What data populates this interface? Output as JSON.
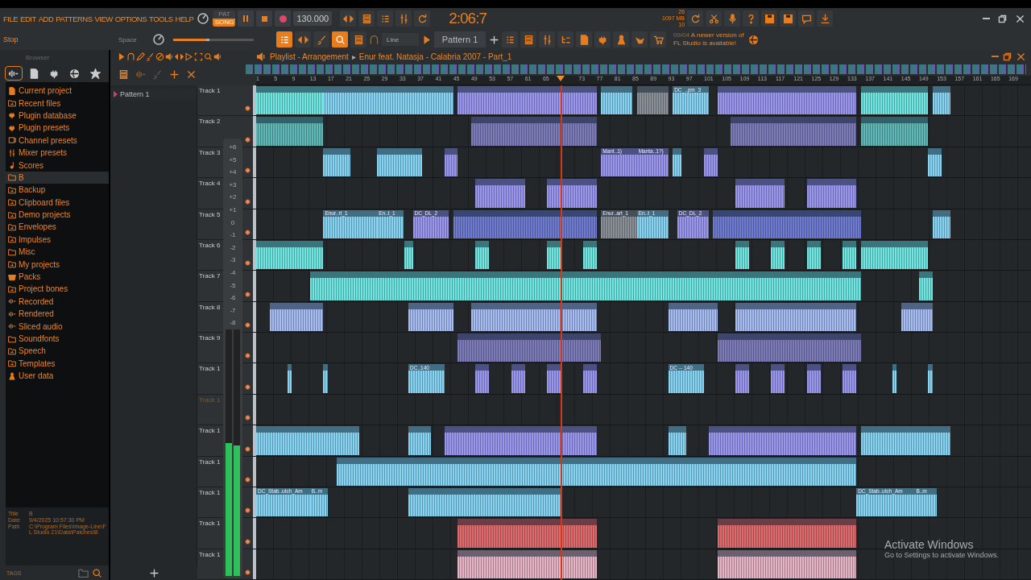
{
  "menu": [
    "FILE",
    "EDIT",
    "ADD",
    "PATTERNS",
    "VIEW",
    "OPTIONS",
    "TOOLS",
    "HELP"
  ],
  "hint": {
    "action": "Stop",
    "key": "Space"
  },
  "transport": {
    "modes": [
      {
        "label": "PAT",
        "selected": false
      },
      {
        "label": "SONG",
        "selected": true
      }
    ],
    "tempo": "130.000",
    "time": "2:06:7"
  },
  "master_volume": {
    "level": 0.45
  },
  "monitor": {
    "cpu": "26",
    "memory": "1097 MB",
    "polyphony": "10"
  },
  "snap": "Line",
  "pattern": "Pattern 1",
  "notice": {
    "date": "09/04",
    "text": "A newer version of FL Studio is available!"
  },
  "browser": {
    "title": "Browser",
    "tabs": [
      {
        "selected": true
      },
      {
        "selected": false
      },
      {
        "selected": false
      },
      {
        "selected": false
      },
      {
        "selected": false
      }
    ],
    "items": [
      {
        "label": "Current project",
        "kind": "project",
        "selected": false
      },
      {
        "label": "Recent files",
        "kind": "shortcut",
        "selected": false
      },
      {
        "label": "Plugin database",
        "kind": "plugin",
        "selected": false
      },
      {
        "label": "Plugin presets",
        "kind": "plugin",
        "selected": false
      },
      {
        "label": "Channel presets",
        "kind": "channel",
        "selected": false
      },
      {
        "label": "Mixer presets",
        "kind": "mixer",
        "selected": false
      },
      {
        "label": "Scores",
        "kind": "score",
        "selected": false
      },
      {
        "label": "B",
        "kind": "folder",
        "selected": true
      },
      {
        "label": "Backup",
        "kind": "shortcut",
        "selected": false
      },
      {
        "label": "Clipboard files",
        "kind": "shortcut",
        "selected": false
      },
      {
        "label": "Demo projects",
        "kind": "shortcut",
        "selected": false
      },
      {
        "label": "Envelopes",
        "kind": "shortcut",
        "selected": false
      },
      {
        "label": "Impulses",
        "kind": "shortcut",
        "selected": false
      },
      {
        "label": "Misc",
        "kind": "folder",
        "selected": false
      },
      {
        "label": "My projects",
        "kind": "shortcut",
        "selected": false
      },
      {
        "label": "Packs",
        "kind": "pack",
        "selected": false
      },
      {
        "label": "Project bones",
        "kind": "shortcut",
        "selected": false
      },
      {
        "label": "Recorded",
        "kind": "audio",
        "selected": false
      },
      {
        "label": "Rendered",
        "kind": "rendered",
        "selected": false
      },
      {
        "label": "Sliced audio",
        "kind": "audio",
        "selected": false
      },
      {
        "label": "Soundfonts",
        "kind": "folder",
        "selected": false
      },
      {
        "label": "Speech",
        "kind": "shortcut",
        "selected": false
      },
      {
        "label": "Templates",
        "kind": "shortcut",
        "selected": false
      },
      {
        "label": "User data",
        "kind": "user",
        "selected": false
      }
    ],
    "info": [
      {
        "label": "Title",
        "value": "B"
      },
      {
        "label": "Date",
        "value": "9/4/2025 10:57:30 PM"
      },
      {
        "label": "Path",
        "value": "C:\\Program Files\\Image-Line\\FL Studio 21\\Data\\Patches\\B"
      }
    ],
    "tags": "TAGS"
  },
  "playlist": {
    "title": "Playlist - Arrangement",
    "separator": "▸",
    "project": "Enur feat. Natasja - Calabria 2007 - Part_1",
    "patterns": [
      "Pattern 1"
    ],
    "ruler": [
      "1",
      "5",
      "9",
      "13",
      "17",
      "21",
      "25",
      "29",
      "33",
      "37",
      "41",
      "45",
      "49",
      "53",
      "57",
      "61",
      "65",
      "73",
      "77",
      "81",
      "85",
      "89",
      "93",
      "97",
      "101",
      "105",
      "109",
      "113",
      "117",
      "121",
      "125",
      "129",
      "133",
      "137",
      "141",
      "145",
      "149",
      "153",
      "157",
      "161",
      "165",
      "169"
    ],
    "playhead": {
      "level": 0.393
    },
    "tracks": [
      {
        "name": "Track 1",
        "dimmed": false,
        "clips": [
          {
            "color": "#6fe6e0"
          },
          {
            "color": "#86d4f2"
          },
          {
            "color": "#9a96ee"
          },
          {
            "color": "#86d4f2"
          },
          {
            "color": "#8a8f96"
          },
          {
            "color": "#86d4f2",
            "label": "DC_..pm_3"
          },
          {
            "color": "#9a96ee"
          },
          {
            "color": "#6fe6e0"
          },
          {
            "color": "#86d4f2"
          }
        ]
      },
      {
        "name": "Track 2",
        "dimmed": false,
        "clips": [
          {
            "color": "#5fb8b4"
          },
          {
            "color": "#7d7ab8"
          },
          {
            "color": "#7d7ab8"
          },
          {
            "color": "#5fb8b4"
          }
        ]
      },
      {
        "name": "Track 3",
        "dimmed": false,
        "clips": [
          {
            "color": "#86d4f2"
          },
          {
            "color": "#86d4f2"
          },
          {
            "color": "#9a96ee"
          },
          {
            "color": "#9a96ee",
            "label": "Mant..1)"
          },
          {
            "color": "#9a96ee",
            "label": "Manta..1?)"
          },
          {
            "color": "#86d4f2"
          },
          {
            "color": "#9a96ee"
          },
          {
            "color": "#86d4f2"
          }
        ]
      },
      {
        "name": "Track 4",
        "dimmed": false,
        "clips": [
          {
            "color": "#9a96ee"
          },
          {
            "color": "#9a96ee"
          },
          {
            "color": "#9a96ee"
          },
          {
            "color": "#9a96ee"
          }
        ]
      },
      {
        "name": "Track 5",
        "dimmed": false,
        "clips": [
          {
            "color": "#86d4f2",
            "label": "Enur..rt_1"
          },
          {
            "color": "#86d4f2",
            "label": "En..t_1"
          },
          {
            "color": "#9a96ee",
            "label": "DC_DL_2"
          },
          {
            "color": "#6f7bd0"
          },
          {
            "color": "#8a8f96",
            "label": "Enur..art_1"
          },
          {
            "color": "#86d4f2",
            "label": "En..t_1"
          },
          {
            "color": "#9a96ee",
            "label": "DC_DL_2"
          },
          {
            "color": "#6f7bd0"
          },
          {
            "color": "#86d4f2"
          }
        ]
      },
      {
        "name": "Track 6",
        "dimmed": false,
        "clips": [
          {
            "color": "#6fe6e0"
          },
          {
            "color": "#6fe6e0"
          },
          {
            "color": "#6fe6e0"
          },
          {
            "color": "#6fe6e0"
          },
          {
            "color": "#6fe6e0"
          },
          {
            "color": "#6fe6e0"
          },
          {
            "color": "#6fe6e0"
          },
          {
            "color": "#6fe6e0"
          },
          {
            "color": "#6fe6e0"
          },
          {
            "color": "#6fe6e0"
          }
        ]
      },
      {
        "name": "Track 7",
        "dimmed": false,
        "clips": [
          {
            "color": "#6fe6e0"
          },
          {
            "color": "#6fe6e0"
          }
        ]
      },
      {
        "name": "Track 8",
        "dimmed": false,
        "clips": [
          {
            "color": "#a7bcf0"
          },
          {
            "color": "#a7bcf0"
          },
          {
            "color": "#a7bcf0"
          },
          {
            "color": "#a7bcf0"
          },
          {
            "color": "#a7bcf0"
          },
          {
            "color": "#a7bcf0"
          }
        ]
      },
      {
        "name": "Track 9",
        "dimmed": false,
        "clips": [
          {
            "color": "#7d7ab8"
          },
          {
            "color": "#7d7ab8"
          }
        ]
      },
      {
        "name": "Track 1",
        "dimmed": false,
        "clips": [
          {
            "color": "#86d4f2"
          },
          {
            "color": "#86d4f2"
          },
          {
            "color": "#86d4f2",
            "label": "DC..140"
          },
          {
            "color": "#9a96ee"
          },
          {
            "color": "#9a96ee"
          },
          {
            "color": "#9a96ee"
          },
          {
            "color": "#9a96ee"
          },
          {
            "color": "#86d4f2",
            "label": "DC -- 140"
          },
          {
            "color": "#9a96ee"
          },
          {
            "color": "#9a96ee"
          },
          {
            "color": "#9a96ee"
          },
          {
            "color": "#9a96ee"
          },
          {
            "color": "#86d4f2"
          },
          {
            "color": "#86d4f2"
          }
        ]
      },
      {
        "name": "Track 1",
        "dimmed": true
      },
      {
        "name": "Track 1",
        "dimmed": false,
        "clips": [
          {
            "color": "#86d4f2"
          },
          {
            "color": "#86d4f2"
          },
          {
            "color": "#9a96ee"
          },
          {
            "color": "#86d4f2"
          },
          {
            "color": "#9a96ee"
          },
          {
            "color": "#86d4f2"
          }
        ]
      },
      {
        "name": "Track 1",
        "dimmed": false,
        "clips": [
          {
            "color": "#86d4f2"
          }
        ]
      },
      {
        "name": "Track 1",
        "dimmed": false,
        "clips": [
          {
            "color": "#86d4f2",
            "label": "DC_Stab..utch_Am"
          },
          {
            "color": "#86d4f2",
            "label": "B..m"
          },
          {
            "color": "#86d4f2"
          },
          {
            "color": "#86d4f2",
            "label": "DC_Stab..utch_Am"
          },
          {
            "color": "#86d4f2",
            "label": "B..m"
          }
        ]
      },
      {
        "name": "Track 1",
        "dimmed": false,
        "clips": [
          {
            "color": "#e06a6a"
          },
          {
            "color": "#e06a6a"
          }
        ]
      },
      {
        "name": "Track 1",
        "dimmed": false,
        "clips": [
          {
            "color": "#e8b4c4"
          },
          {
            "color": "#e8b4c4"
          }
        ]
      }
    ]
  },
  "meter": {
    "scale": [
      "+6",
      "+5",
      "+4",
      "+3",
      "+2",
      "+1",
      "0",
      "-1",
      "-2",
      "-3",
      "-4",
      "-5",
      "-6",
      "-7",
      "-8"
    ],
    "channels": [
      {
        "level": 0.54
      },
      {
        "level": 0.53
      }
    ]
  },
  "activation": {
    "title": "Activate Windows",
    "text": "Go to Settings to activate Windows."
  }
}
